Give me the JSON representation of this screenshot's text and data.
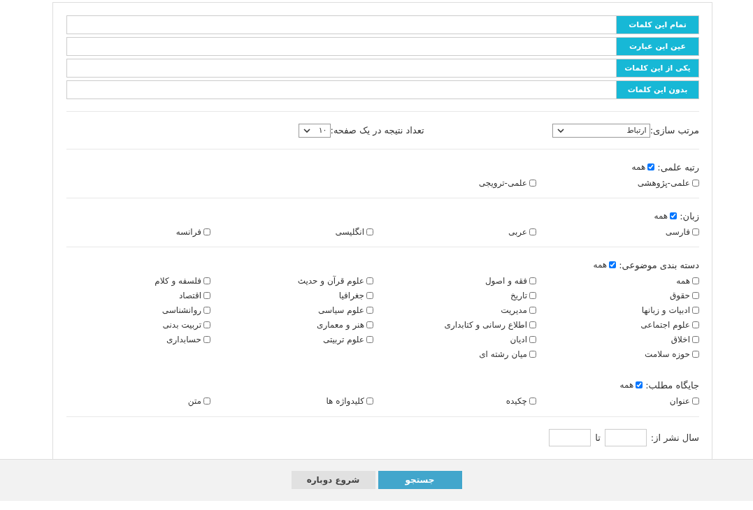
{
  "search_fields": [
    {
      "label": "تمام این کلمات"
    },
    {
      "label": "عین این عبارت"
    },
    {
      "label": "یکی از این کلمات"
    },
    {
      "label": "بدون این کلمات"
    }
  ],
  "sort": {
    "label": "مرتب سازی:",
    "value": "ارتباط"
  },
  "page_size": {
    "label": "تعداد نتیجه در یک صفحه:",
    "value": "۱۰"
  },
  "filters": [
    {
      "label": "رتبه علمی:",
      "all": {
        "label": "همه",
        "checked": true
      },
      "options": [
        {
          "label": "علمی-پژوهشی",
          "checked": false
        },
        {
          "label": "علمی-ترویجی",
          "checked": false
        }
      ]
    },
    {
      "label": "زبان:",
      "all": {
        "label": "همه",
        "checked": true
      },
      "options": [
        {
          "label": "فارسی",
          "checked": false
        },
        {
          "label": "عربی",
          "checked": false
        },
        {
          "label": "انگلیسی",
          "checked": false
        },
        {
          "label": "فرانسه",
          "checked": false
        }
      ]
    },
    {
      "label": "دسته بندی موضوعی:",
      "all": {
        "label": "همه",
        "checked": true
      },
      "options": [
        {
          "label": "همه",
          "checked": false
        },
        {
          "label": "فقه و اصول",
          "checked": false
        },
        {
          "label": "علوم قرآن و حدیث",
          "checked": false
        },
        {
          "label": "فلسفه و کلام",
          "checked": false
        },
        {
          "label": "حقوق",
          "checked": false
        },
        {
          "label": "تاریخ",
          "checked": false
        },
        {
          "label": "جغرافیا",
          "checked": false
        },
        {
          "label": "اقتصاد",
          "checked": false
        },
        {
          "label": "ادبیات و زبانها",
          "checked": false
        },
        {
          "label": "مدیریت",
          "checked": false
        },
        {
          "label": "علوم سیاسی",
          "checked": false
        },
        {
          "label": "روانشناسی",
          "checked": false
        },
        {
          "label": "علوم اجتماعی",
          "checked": false
        },
        {
          "label": "اطلاع رسانی و کتابداری",
          "checked": false
        },
        {
          "label": "هنر و معماری",
          "checked": false
        },
        {
          "label": "تربیت بدنی",
          "checked": false
        },
        {
          "label": "اخلاق",
          "checked": false
        },
        {
          "label": "ادیان",
          "checked": false
        },
        {
          "label": "علوم تربیتی",
          "checked": false
        },
        {
          "label": "حسابداری",
          "checked": false
        },
        {
          "label": "حوزه سلامت",
          "checked": false
        },
        {
          "label": "میان رشته ای",
          "checked": false
        }
      ]
    },
    {
      "label": "جایگاه مطلب:",
      "all": {
        "label": "همه",
        "checked": true
      },
      "options": [
        {
          "label": "عنوان",
          "checked": false
        },
        {
          "label": "چکیده",
          "checked": false
        },
        {
          "label": "کلیدواژه ها",
          "checked": false
        },
        {
          "label": "متن",
          "checked": false
        }
      ]
    }
  ],
  "year": {
    "label": "سال نشر از:",
    "to_label": "تا"
  },
  "buttons": [
    {
      "label": "جستجو",
      "kind": "primary"
    },
    {
      "label": "شروع دوباره",
      "kind": "secondary"
    }
  ]
}
